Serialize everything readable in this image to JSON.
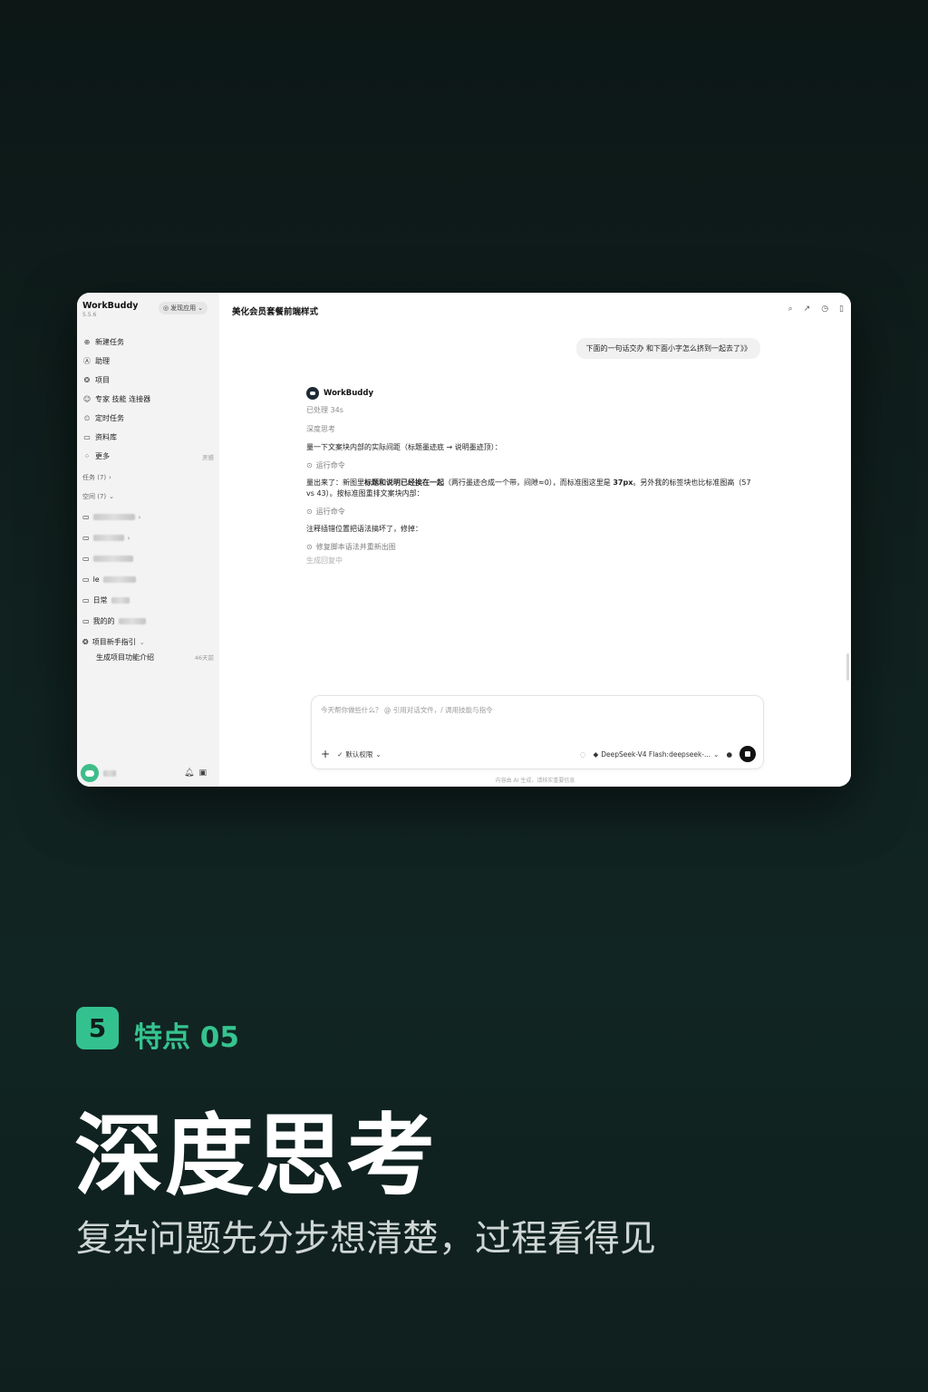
{
  "sidebar": {
    "app_name": "WorkBuddy",
    "version": "5.5.6",
    "discover_label": "发现应用",
    "nav": [
      {
        "icon": "plus-circle-icon",
        "label": "新建任务"
      },
      {
        "icon": "assistant-icon",
        "label": "助理"
      },
      {
        "icon": "project-icon",
        "label": "项目"
      },
      {
        "icon": "expert-icon",
        "label": "专家 技能 连接器"
      },
      {
        "icon": "clock-task-icon",
        "label": "定时任务"
      },
      {
        "icon": "library-icon",
        "label": "资料库"
      },
      {
        "icon": "more-grid-icon",
        "label": "更多",
        "tag": "灵感"
      }
    ],
    "tasks_label": "任务 (7)",
    "spaces_label": "空间 (7)",
    "spaces": [
      {
        "prefix": ""
      },
      {
        "prefix": ""
      },
      {
        "prefix": ""
      },
      {
        "prefix": "le"
      },
      {
        "prefix": "日常"
      },
      {
        "prefix": "我的的"
      }
    ],
    "guide_label": "项目新手指引",
    "guide_item": "生成项目功能介绍",
    "guide_time": "46天前"
  },
  "main": {
    "title": "美化会员套餐前端样式",
    "user_message": "下面的一句话交办 和下面小字怎么挤到一起去了》》",
    "agent_name": "WorkBuddy",
    "processed": "已处理 34s",
    "thinking_label": "深度思考",
    "para1": "量一下文案块内部的实际间距（标题墨迹底 → 说明墨迹顶）：",
    "step1": "运行命令",
    "para2_a": "量出来了：新图里",
    "para2_b": "标题和说明已经挨在一起",
    "para2_c": "（两行墨迹合成一个带，间隙≈0），而标准图这里是 ",
    "para2_d": "37px",
    "para2_e": "。另外我的标签块也比标准图高（57 vs 43）。按标准图重排文案块内部：",
    "step2": "运行命令",
    "para3": "注释插错位置把语法搞坏了，修掉：",
    "step3": "修复脚本语法并重新出图",
    "generating": "生成回复中",
    "composer_placeholder": "今天帮你做些什么？ @ 引用对话文件，/ 调用技能与指令",
    "permission_label": "默认权限",
    "model_label": "DeepSeek-V4 Flash:deepseek-...",
    "disclaimer": "内容由 AI 生成，请核实重要信息"
  },
  "feature": {
    "number": "5",
    "label": "特点 05",
    "headline": "深度思考",
    "subline": "复杂问题先分步想清楚，过程看得见"
  },
  "colors": {
    "accent": "#35c48f",
    "background": "#0f1f1d"
  }
}
